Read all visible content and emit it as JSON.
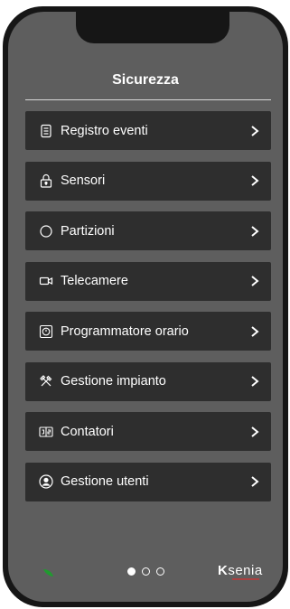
{
  "header": {
    "title": "Sicurezza"
  },
  "menu": {
    "items": [
      {
        "label": "Registro eventi",
        "icon": "event-log-icon"
      },
      {
        "label": "Sensori",
        "icon": "lock-icon"
      },
      {
        "label": "Partizioni",
        "icon": "circle-icon"
      },
      {
        "label": "Telecamere",
        "icon": "camera-icon"
      },
      {
        "label": "Programmatore orario",
        "icon": "timer-icon"
      },
      {
        "label": "Gestione impianto",
        "icon": "tools-icon"
      },
      {
        "label": "Contatori",
        "icon": "counter-icon"
      },
      {
        "label": "Gestione utenti",
        "icon": "user-icon"
      }
    ]
  },
  "footer": {
    "pages": 3,
    "active_page": 1,
    "brand": {
      "k": "K",
      "rest": "senia"
    }
  },
  "colors": {
    "leaf": "#1f9b2f",
    "background": "#5e5e5e",
    "item_bg": "#2e2e2e",
    "brand_accent": "#c93434"
  }
}
